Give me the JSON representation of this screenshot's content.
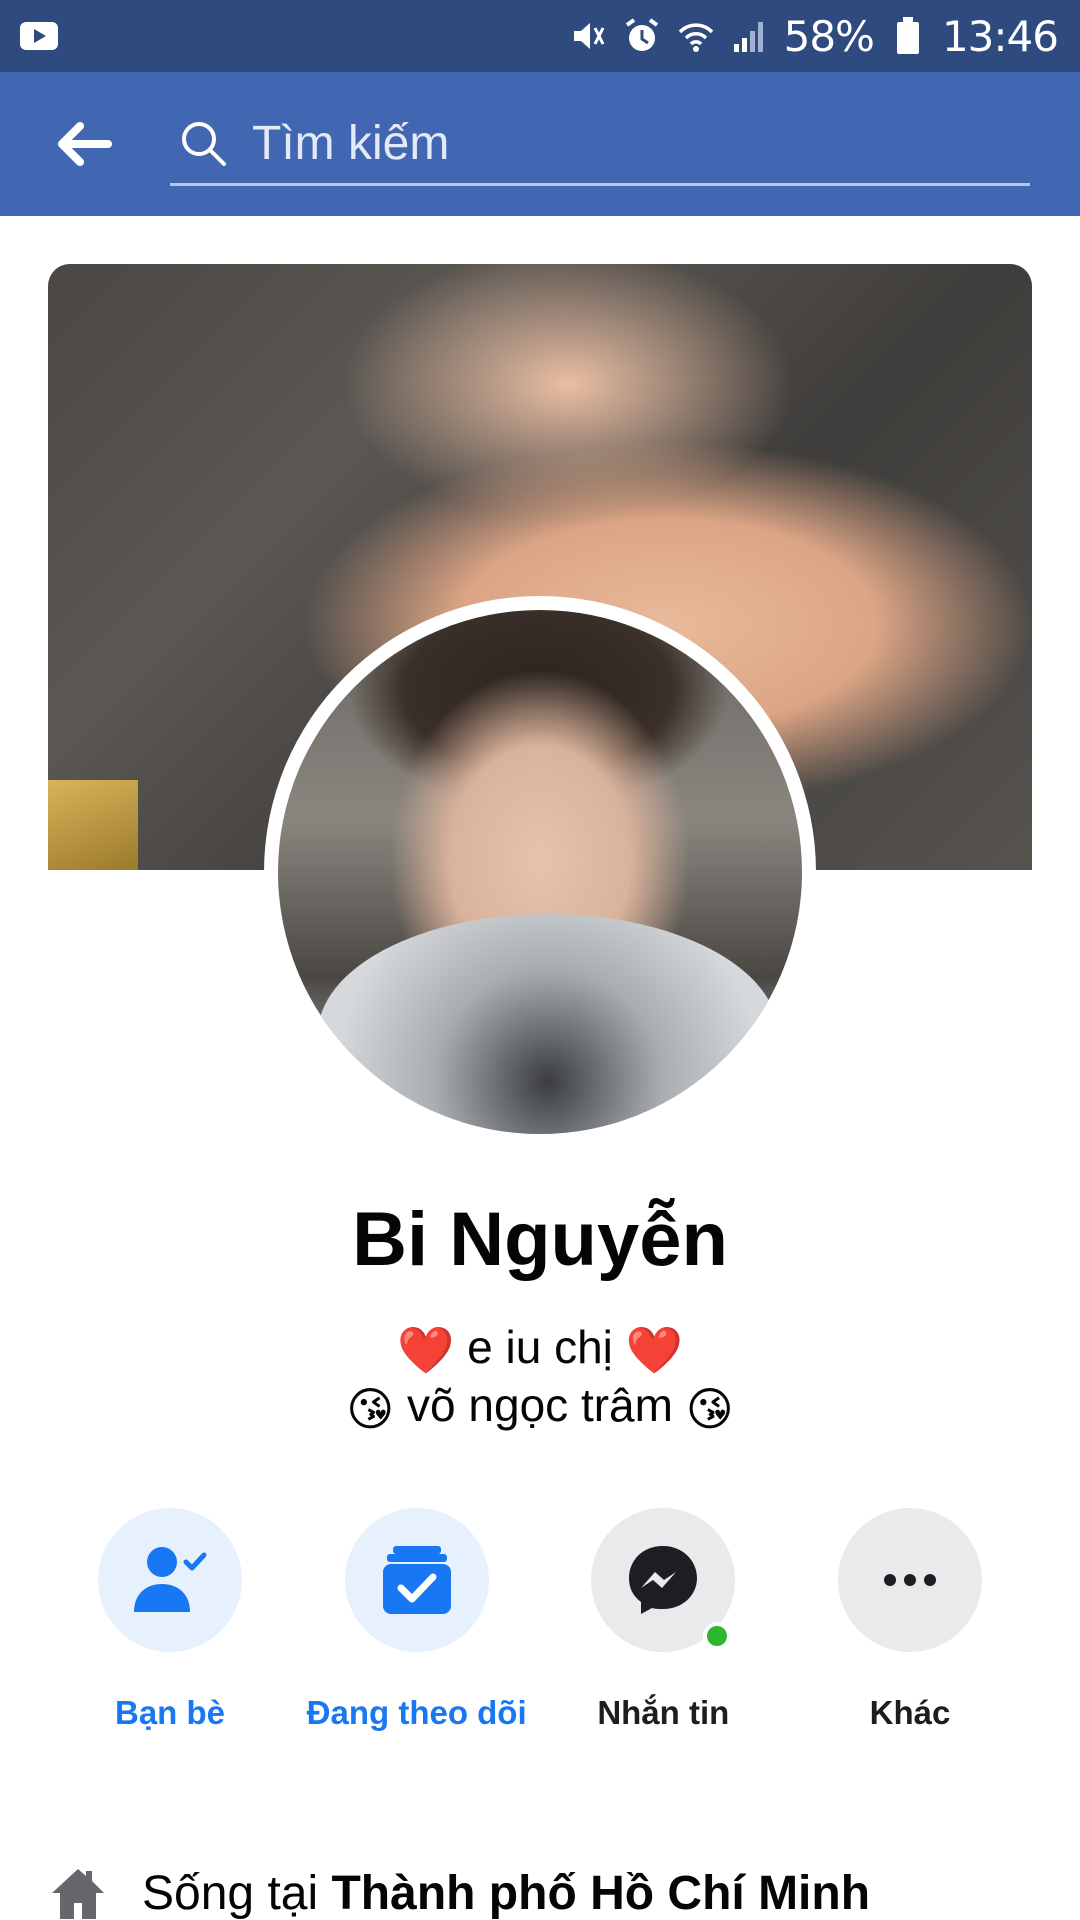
{
  "status_bar": {
    "battery": "58%",
    "time": "13:46",
    "icons": [
      "youtube-icon",
      "mute-icon",
      "alarm-icon",
      "wifi-icon",
      "signal-icon",
      "battery-icon"
    ]
  },
  "header": {
    "back_icon": "arrow-left-icon",
    "search_placeholder": "Tìm kiếm"
  },
  "profile": {
    "name": "Bi Nguyễn",
    "bio_line1_text": "e iu chị",
    "bio_line1_emoji": "❤️",
    "bio_line2_text": "võ ngọc trâm",
    "bio_line2_emoji": "😘"
  },
  "actions": [
    {
      "label": "Bạn bè",
      "icon": "friends-check-icon",
      "color": "#1877f2"
    },
    {
      "label": "Đang theo dõi",
      "icon": "following-check-icon",
      "color": "#1877f2"
    },
    {
      "label": "Nhắn tin",
      "icon": "messenger-icon",
      "color": "#1c1e21"
    },
    {
      "label": "Khác",
      "icon": "more-icon",
      "color": "#1c1e21"
    }
  ],
  "lives_in": {
    "prefix": "Sống tại",
    "city": "Thành phố Hồ Chí Minh"
  },
  "colors": {
    "header": "#4267b2",
    "status_bar": "#2f4a7f",
    "accent": "#1877f2",
    "online": "#2fb62f"
  }
}
